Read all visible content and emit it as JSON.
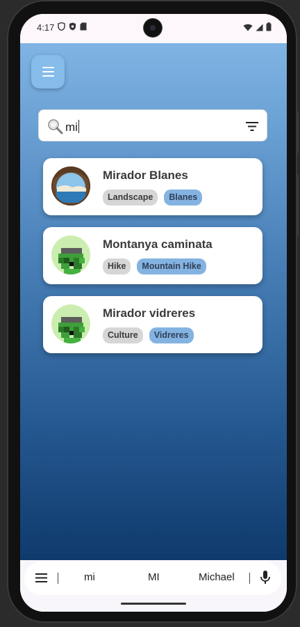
{
  "status_bar": {
    "time": "4:17",
    "icons_left": [
      "shield-icon",
      "vpn-icon",
      "sd-card-icon"
    ],
    "icons_right": [
      "wifi-icon",
      "signal-icon",
      "battery-icon"
    ]
  },
  "search": {
    "value": "mi",
    "icon": "search-icon",
    "filter_icon": "filter-icon"
  },
  "results": [
    {
      "title": "Mirador Blanes",
      "tags": [
        "Landscape",
        "Blanes"
      ],
      "avatar": "photo"
    },
    {
      "title": "Montanya caminata",
      "tags": [
        "Hike",
        "Mountain Hike"
      ],
      "avatar": "pixel"
    },
    {
      "title": "Mirador vidreres",
      "tags": [
        "Culture",
        "Vidreres"
      ],
      "avatar": "pixel"
    }
  ],
  "keyboard": {
    "suggestions": [
      "mi",
      "MI",
      "Michael"
    ]
  },
  "colors": {
    "gradient_top": "#7fb4e4",
    "gradient_bottom": "#0f3a6c",
    "tag_gray": "#d6d6d6",
    "tag_blue": "#84b3e2"
  }
}
